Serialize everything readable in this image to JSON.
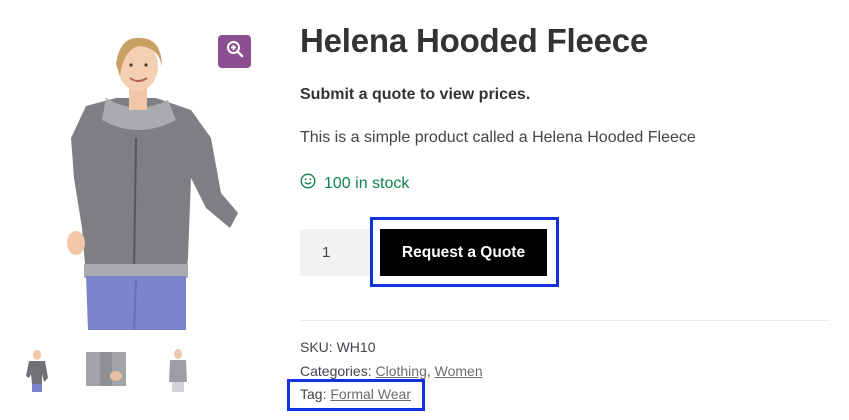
{
  "product": {
    "title": "Helena Hooded Fleece",
    "quote_note": "Submit a quote to view prices.",
    "description": "This is a simple product called a Helena Hooded Fleece",
    "stock": "100 in stock",
    "quantity": "1",
    "quote_button_label": "Request a Quote"
  },
  "meta": {
    "sku_label": "SKU:",
    "sku_value": "WH10",
    "categories_label": "Categories:",
    "categories": [
      "Clothing",
      "Women"
    ],
    "categories_separator": ",",
    "tag_label": "Tag:",
    "tag": "Formal Wear"
  },
  "gallery": {
    "zoom_icon": "magnifier-plus-icon",
    "thumbnails": [
      "front-view",
      "detail-view",
      "side-view"
    ]
  },
  "colors": {
    "accent_purple": "#8b4f8f",
    "stock_green": "#0f834d",
    "button_black": "#000000",
    "highlight_blue": "#1133dd"
  }
}
